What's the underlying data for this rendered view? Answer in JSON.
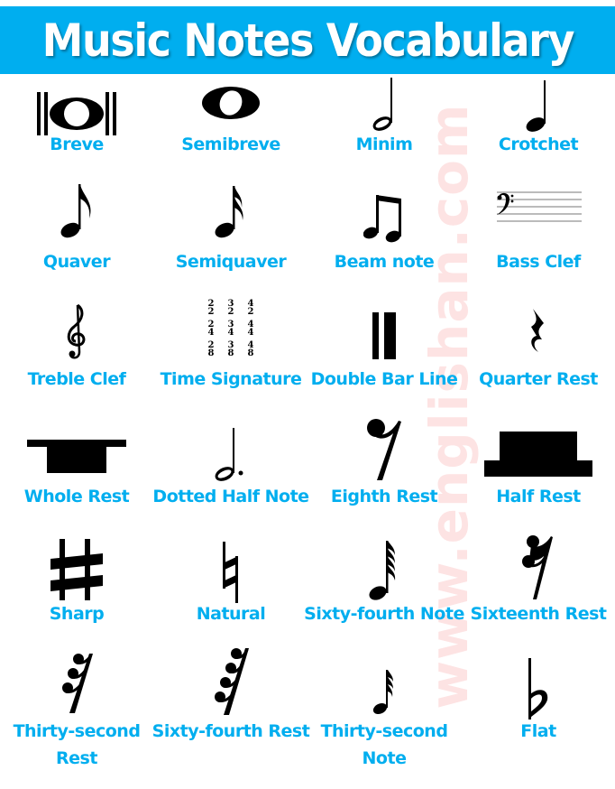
{
  "header": {
    "title": "Music Notes Vocabulary",
    "background": "#00aeef",
    "text_color": "#ffffff"
  },
  "watermark": {
    "text": "www.englishan.com",
    "color": "#fde3e3"
  },
  "label_color": "#00aeef",
  "items": [
    {
      "label": "Breve",
      "icon": "breve-icon"
    },
    {
      "label": "Semibreve",
      "icon": "semibreve-icon"
    },
    {
      "label": "Minim",
      "icon": "minim-icon"
    },
    {
      "label": "Crotchet",
      "icon": "crotchet-icon"
    },
    {
      "label": "Quaver",
      "icon": "quaver-icon"
    },
    {
      "label": "Semiquaver",
      "icon": "semiquaver-icon"
    },
    {
      "label": "Beam note",
      "icon": "beam-note-icon"
    },
    {
      "label": "Bass Clef",
      "icon": "bass-clef-icon"
    },
    {
      "label": "Treble Clef",
      "icon": "treble-clef-icon"
    },
    {
      "label": "Time Signature",
      "icon": "time-signature-icon",
      "time_signatures": [
        [
          "2",
          "2"
        ],
        [
          "3",
          "2"
        ],
        [
          "4",
          "2"
        ],
        [
          "2",
          "4"
        ],
        [
          "3",
          "4"
        ],
        [
          "4",
          "4"
        ],
        [
          "2",
          "8"
        ],
        [
          "3",
          "8"
        ],
        [
          "4",
          "8"
        ]
      ]
    },
    {
      "label": "Double Bar Line",
      "icon": "double-bar-line-icon"
    },
    {
      "label": "Quarter Rest",
      "icon": "quarter-rest-icon"
    },
    {
      "label": "Whole Rest",
      "icon": "whole-rest-icon"
    },
    {
      "label": "Dotted Half Note",
      "icon": "dotted-half-note-icon"
    },
    {
      "label": "Eighth Rest",
      "icon": "eighth-rest-icon"
    },
    {
      "label": "Half Rest",
      "icon": "half-rest-icon"
    },
    {
      "label": "Sharp",
      "icon": "sharp-icon"
    },
    {
      "label": "Natural",
      "icon": "natural-icon"
    },
    {
      "label": "Sixty-fourth Note",
      "icon": "sixty-fourth-note-icon"
    },
    {
      "label": "Sixteenth Rest",
      "icon": "sixteenth-rest-icon"
    },
    {
      "label": "Thirty-second Rest",
      "icon": "thirty-second-rest-icon"
    },
    {
      "label": "Sixty-fourth Rest",
      "icon": "sixty-fourth-rest-icon"
    },
    {
      "label": "Thirty-second Note",
      "icon": "thirty-second-note-icon"
    },
    {
      "label": "Flat",
      "icon": "flat-icon"
    }
  ]
}
